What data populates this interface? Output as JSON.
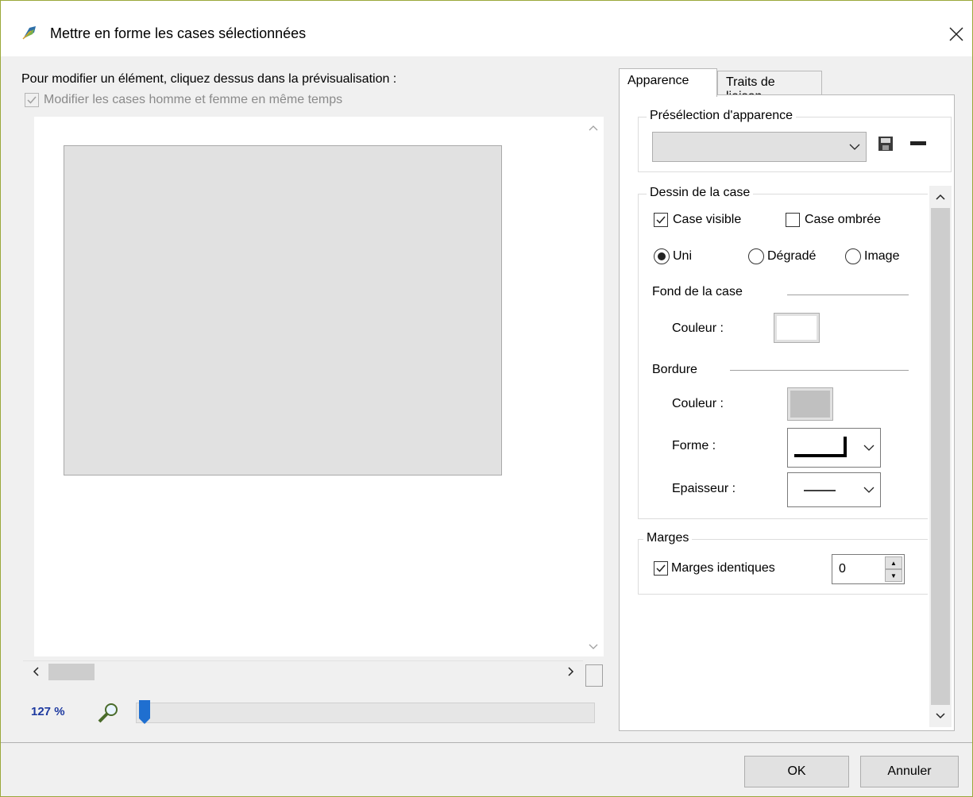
{
  "window": {
    "title": "Mettre en forme les cases sélectionnées",
    "close_glyph": "✕"
  },
  "left": {
    "instruction": "Pour modifier un élément, cliquez dessus dans la prévisualisation :",
    "sync_checkbox_label": "Modifier les cases homme et femme en même temps",
    "sync_checked": true,
    "zoom_label": "127 %",
    "zoom_fraction": 0.03
  },
  "tabs": [
    {
      "label": "Apparence",
      "active": true
    },
    {
      "label": "Traits de liaison",
      "active": false
    }
  ],
  "preset": {
    "group_title": "Présélection d'apparence",
    "selected_value": ""
  },
  "dessin": {
    "group_title": "Dessin de la case",
    "case_visible_label": "Case visible",
    "case_visible_checked": true,
    "case_ombree_label": "Case ombrée",
    "case_ombree_checked": false,
    "radio_uni": "Uni",
    "radio_degrade": "Dégradé",
    "radio_image": "Image",
    "radio_selected": "Uni",
    "fond_title": "Fond de la case",
    "fond_couleur_label": "Couleur :",
    "fond_color": "#ffffff",
    "bordure_title": "Bordure",
    "bordure_couleur_label": "Couleur :",
    "bordure_color": "#c0c0c0",
    "forme_label": "Forme :",
    "epaisseur_label": "Epaisseur :"
  },
  "marges": {
    "group_title": "Marges",
    "identiques_label": "Marges identiques",
    "identiques_checked": true,
    "value": "0"
  },
  "footer": {
    "ok_label": "OK",
    "cancel_label": "Annuler"
  },
  "colors": {
    "zoom_text": "#1e3aa0",
    "slider_handle": "#1f6fd0"
  }
}
